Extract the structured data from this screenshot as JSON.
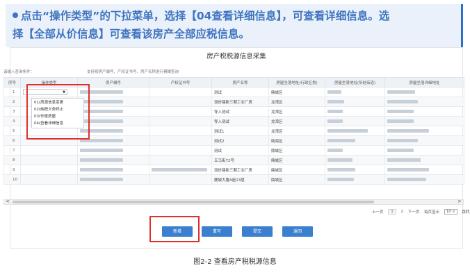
{
  "banner": {
    "line1": "点击“操作类型”的下拉菜单，选择【04查看详细信息】，可查看详细信息。选",
    "line2": "择【全部从价信息】可查看该房产全部应税信息。"
  },
  "app": {
    "title": "房产税税源信息采集",
    "query_label": "请输入查询条件：",
    "query_hint": "支持按房产编号、产权证书号、房产名称进行模糊查询"
  },
  "table": {
    "headers": [
      "序号",
      "操作类型",
      "房产编号",
      "产权证书号",
      "房产名称",
      "房屋坐落地址(行政区划)",
      "房屋坐落地址(所处街道)",
      "房屋坐落详细地址"
    ],
    "rows": [
      {
        "idx": "1",
        "name": "测试",
        "district": "鼎城区"
      },
      {
        "idx": "2",
        "name": "双岭路新三期工业厂房",
        "district": "龙湾区"
      },
      {
        "idx": "3",
        "name": "导入测试",
        "district": "龙湾区"
      },
      {
        "idx": "4",
        "name": "导入测试",
        "district": "龙湾区"
      },
      {
        "idx": "5",
        "name": "测试1",
        "district": "龙湾区"
      },
      {
        "idx": "6",
        "name": "测试2",
        "district": "瓯海区"
      },
      {
        "idx": "7",
        "name": "测试",
        "district": "鼎城区"
      },
      {
        "idx": "8",
        "name": "五马街72号",
        "district": "鼎城区"
      },
      {
        "idx": "9",
        "name": "双岭路新三期工业厂房",
        "district": "鼎城区"
      },
      {
        "idx": "10",
        "name": "鹿城大厦A座13层",
        "district": "鼎城区"
      }
    ]
  },
  "dropdown": {
    "options": [
      "01(房源信息变更",
      "02(纳税义务终止",
      "03(作废房屋",
      "04(查看详细信息"
    ]
  },
  "scroll": {
    "left": "<",
    "right": ">"
  },
  "pager": {
    "prev": "上一页",
    "page1": "1",
    "page2": "2",
    "next": "下一页",
    "per_page_label": "每页显示",
    "per_page": "10 ∨",
    "goto": "跳转至"
  },
  "buttons": {
    "add": "新增",
    "reset": "重写",
    "submit": "提交",
    "back": "返回"
  },
  "caption": "图2-2 查看房产税税源信息"
}
